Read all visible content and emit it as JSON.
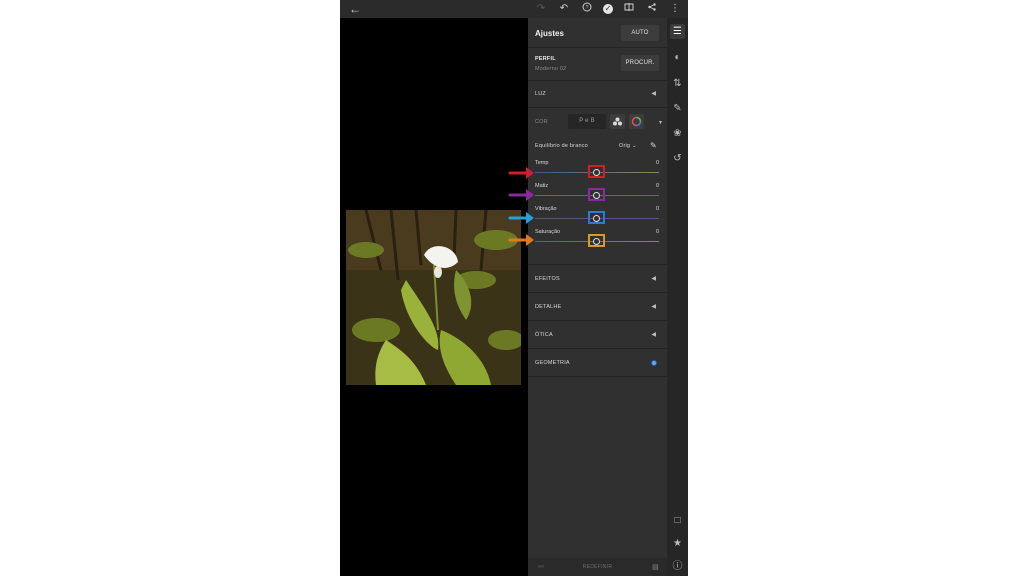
{
  "panel": {
    "title": "Ajustes",
    "auto_label": "AUTO",
    "profile": {
      "label": "PERFIL",
      "value": "Moderno 02",
      "browse_label": "PROCUR."
    },
    "sections": {
      "luz": "LUZ",
      "cor": "COR",
      "efeitos": "EFEITOS",
      "detalhe": "DETALHE",
      "otica": "ÓTICA",
      "geometria": "GEOMETRIA"
    },
    "cor_mode_button": "P e B",
    "white_balance": {
      "label": "Equilíbrio de branco",
      "value": "Orig"
    },
    "sliders": [
      {
        "label": "Temp",
        "value": "0",
        "highlight_color": "#d11f2a",
        "track_color": "#4a6a8a"
      },
      {
        "label": "Matiz",
        "value": "0",
        "highlight_color": "#8a2a9e",
        "track_color": "#5a6e5a"
      },
      {
        "label": "Vibração",
        "value": "0",
        "highlight_color": "#2a7bd1",
        "track_color": "#6a5a8a"
      },
      {
        "label": "Saturação",
        "value": "0",
        "highlight_color": "#d89a1f",
        "track_color": "#6a6a5a"
      }
    ],
    "reset_label": "REDEFINIR"
  },
  "arrows": [
    "#d11f2a",
    "#8a2a9e",
    "#2a9ed8",
    "#e07a1f"
  ],
  "icons": {
    "topbar": [
      "back-icon",
      "redo-icon",
      "undo-icon",
      "help-icon",
      "done-icon",
      "compare-icon",
      "share-icon",
      "more-icon"
    ],
    "rail": [
      "adjust-icon",
      "masking-icon",
      "crop-icon",
      "healing-icon",
      "presets-icon",
      "history-icon",
      "comment-icon",
      "star-icon",
      "info-icon"
    ]
  }
}
